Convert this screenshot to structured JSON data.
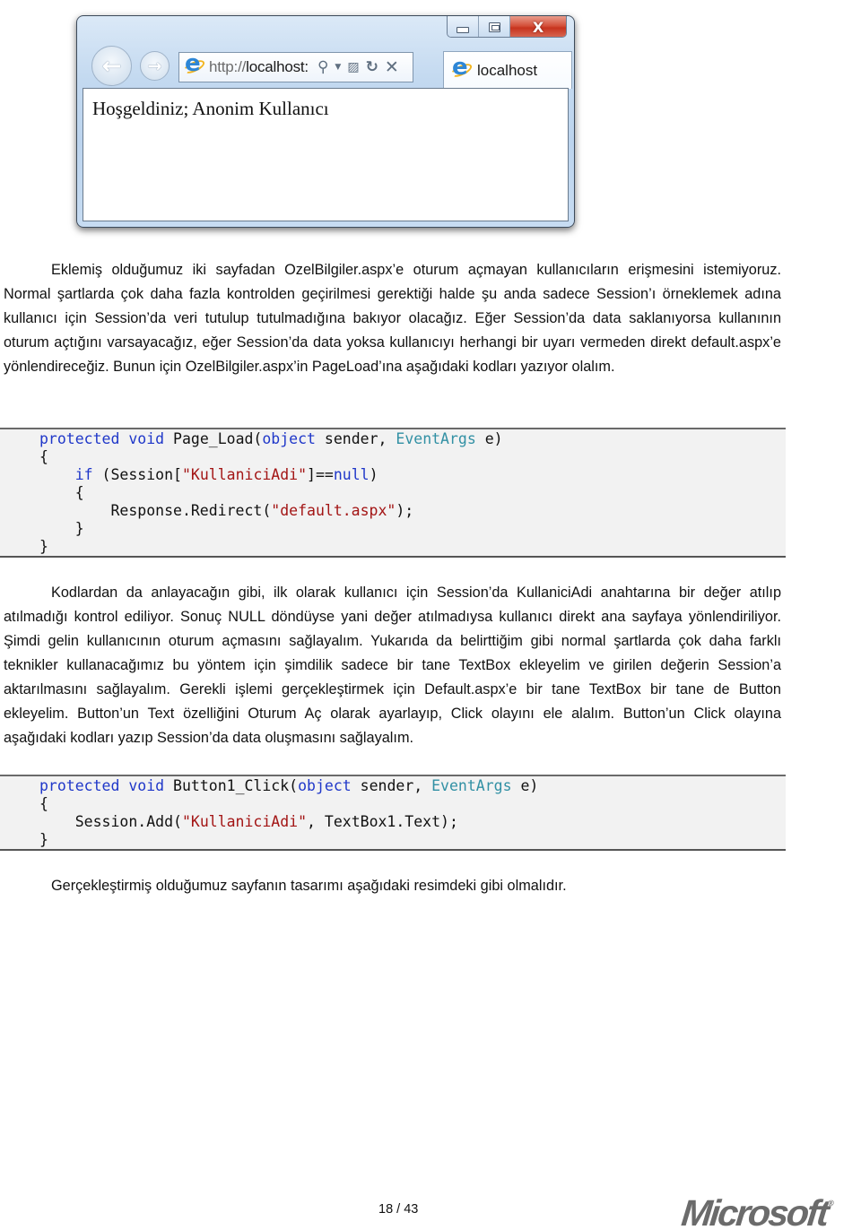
{
  "browser": {
    "url_prefix": "http://",
    "url_host": "localhost:",
    "tab_title": "localhost",
    "page_content": "Hoşgeldiniz; Anonim Kullanıcı",
    "icons": {
      "back": "←",
      "forward": "→",
      "search": "⚲",
      "dropdown": "▼",
      "compat": "▨",
      "refresh": "↻",
      "stop": "✕",
      "minimize": "minimize-icon",
      "maximize": "maximize-icon",
      "close": "X"
    }
  },
  "paragraphs": [
    "Eklemiş olduğumuz iki sayfadan OzelBilgiler.aspx’e oturum açmayan kullanıcıların erişmesini istemiyoruz. Normal şartlarda çok daha fazla kontrolden geçirilmesi gerektiği halde şu anda sadece Session’ı örneklemek adına kullanıcı için Session’da veri tutulup tutulmadığına bakıyor olacağız. Eğer Session’da data saklanıyorsa kullanının oturum açtığını varsayacağız, eğer Session’da data yoksa kullanıcıyı herhangi bir uyarı vermeden direkt default.aspx’e yönlendireceğiz. Bunun için OzelBilgiler.aspx’in PageLoad’ına aşağıdaki kodları yazıyor olalım.",
    "Kodlardan da anlayacağın gibi, ilk olarak kullanıcı için Session’da KullaniciAdi anahtarına bir değer atılıp atılmadığı kontrol ediliyor. Sonuç NULL döndüyse yani değer atılmadıysa kullanıcı direkt ana sayfaya yönlendiriliyor. Şimdi gelin kullanıcının oturum açmasını sağlayalım. Yukarıda da belirttiğim gibi normal şartlarda çok daha farklı teknikler kullanacağımız bu yöntem için şimdilik sadece bir tane TextBox ekleyelim ve girilen değerin Session’a aktarılmasını sağlayalım. Gerekli işlemi gerçekleştirmek için Default.aspx’e bir tane TextBox bir tane de Button ekleyelim. Button’un Text özelliğini Oturum Aç olarak ayarlayıp, Click olayını ele alalım. Button’un Click olayına aşağıdaki kodları yazıp Session’da data oluşmasını sağlayalım.",
    "Gerçekleştirmiş olduğumuz sayfanın tasarımı aşağıdaki resimdeki gibi olmalıdır."
  ],
  "code1": {
    "l1": {
      "kw1": "protected",
      "sp1": " ",
      "kw2": "void",
      "t1": " Page_Load(",
      "kw3": "object",
      "t2": " sender, ",
      "type": "EventArgs",
      "t3": " e)"
    },
    "l2": "{",
    "l3": {
      "indent": "    ",
      "kw": "if",
      "t1": " (Session[",
      "str": "\"KullaniciAdi\"",
      "t2": "]==",
      "kw2": "null",
      "t3": ")"
    },
    "l4": "    {",
    "l5": {
      "t1": "        Response.Redirect(",
      "str": "\"default.aspx\"",
      "t2": ");"
    },
    "l6": "    }",
    "l7": "}"
  },
  "code2": {
    "l1": {
      "kw1": "protected",
      "sp1": " ",
      "kw2": "void",
      "t1": " Button1_Click(",
      "kw3": "object",
      "t2": " sender, ",
      "type": "EventArgs",
      "t3": " e)"
    },
    "l2": "{",
    "l3": {
      "t1": "    Session.Add(",
      "str": "\"KullaniciAdi\"",
      "t2": ", TextBox1.Text);"
    },
    "l4": "}"
  },
  "footer": {
    "page_number": "18 / 43",
    "logo_text": "Microsoft",
    "logo_mark": "®"
  }
}
